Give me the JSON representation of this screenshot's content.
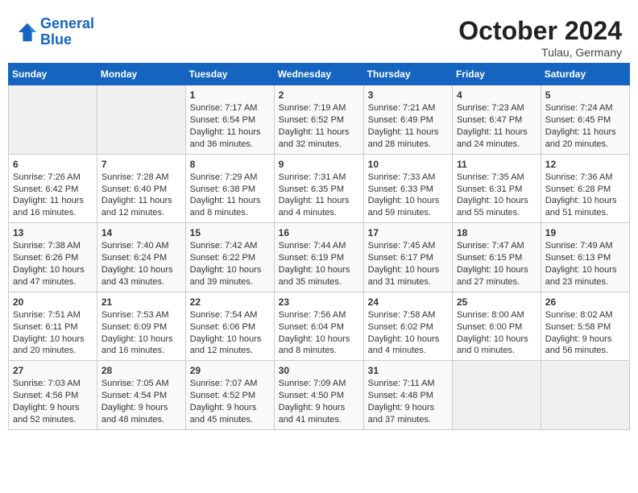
{
  "header": {
    "logo_line1": "General",
    "logo_line2": "Blue",
    "month_title": "October 2024",
    "location": "Tulau, Germany"
  },
  "days_of_week": [
    "Sunday",
    "Monday",
    "Tuesday",
    "Wednesday",
    "Thursday",
    "Friday",
    "Saturday"
  ],
  "weeks": [
    [
      {
        "day": "",
        "content": ""
      },
      {
        "day": "",
        "content": ""
      },
      {
        "day": "1",
        "content": "Sunrise: 7:17 AM\nSunset: 6:54 PM\nDaylight: 11 hours and 36 minutes."
      },
      {
        "day": "2",
        "content": "Sunrise: 7:19 AM\nSunset: 6:52 PM\nDaylight: 11 hours and 32 minutes."
      },
      {
        "day": "3",
        "content": "Sunrise: 7:21 AM\nSunset: 6:49 PM\nDaylight: 11 hours and 28 minutes."
      },
      {
        "day": "4",
        "content": "Sunrise: 7:23 AM\nSunset: 6:47 PM\nDaylight: 11 hours and 24 minutes."
      },
      {
        "day": "5",
        "content": "Sunrise: 7:24 AM\nSunset: 6:45 PM\nDaylight: 11 hours and 20 minutes."
      }
    ],
    [
      {
        "day": "6",
        "content": "Sunrise: 7:26 AM\nSunset: 6:42 PM\nDaylight: 11 hours and 16 minutes."
      },
      {
        "day": "7",
        "content": "Sunrise: 7:28 AM\nSunset: 6:40 PM\nDaylight: 11 hours and 12 minutes."
      },
      {
        "day": "8",
        "content": "Sunrise: 7:29 AM\nSunset: 6:38 PM\nDaylight: 11 hours and 8 minutes."
      },
      {
        "day": "9",
        "content": "Sunrise: 7:31 AM\nSunset: 6:35 PM\nDaylight: 11 hours and 4 minutes."
      },
      {
        "day": "10",
        "content": "Sunrise: 7:33 AM\nSunset: 6:33 PM\nDaylight: 10 hours and 59 minutes."
      },
      {
        "day": "11",
        "content": "Sunrise: 7:35 AM\nSunset: 6:31 PM\nDaylight: 10 hours and 55 minutes."
      },
      {
        "day": "12",
        "content": "Sunrise: 7:36 AM\nSunset: 6:28 PM\nDaylight: 10 hours and 51 minutes."
      }
    ],
    [
      {
        "day": "13",
        "content": "Sunrise: 7:38 AM\nSunset: 6:26 PM\nDaylight: 10 hours and 47 minutes."
      },
      {
        "day": "14",
        "content": "Sunrise: 7:40 AM\nSunset: 6:24 PM\nDaylight: 10 hours and 43 minutes."
      },
      {
        "day": "15",
        "content": "Sunrise: 7:42 AM\nSunset: 6:22 PM\nDaylight: 10 hours and 39 minutes."
      },
      {
        "day": "16",
        "content": "Sunrise: 7:44 AM\nSunset: 6:19 PM\nDaylight: 10 hours and 35 minutes."
      },
      {
        "day": "17",
        "content": "Sunrise: 7:45 AM\nSunset: 6:17 PM\nDaylight: 10 hours and 31 minutes."
      },
      {
        "day": "18",
        "content": "Sunrise: 7:47 AM\nSunset: 6:15 PM\nDaylight: 10 hours and 27 minutes."
      },
      {
        "day": "19",
        "content": "Sunrise: 7:49 AM\nSunset: 6:13 PM\nDaylight: 10 hours and 23 minutes."
      }
    ],
    [
      {
        "day": "20",
        "content": "Sunrise: 7:51 AM\nSunset: 6:11 PM\nDaylight: 10 hours and 20 minutes."
      },
      {
        "day": "21",
        "content": "Sunrise: 7:53 AM\nSunset: 6:09 PM\nDaylight: 10 hours and 16 minutes."
      },
      {
        "day": "22",
        "content": "Sunrise: 7:54 AM\nSunset: 6:06 PM\nDaylight: 10 hours and 12 minutes."
      },
      {
        "day": "23",
        "content": "Sunrise: 7:56 AM\nSunset: 6:04 PM\nDaylight: 10 hours and 8 minutes."
      },
      {
        "day": "24",
        "content": "Sunrise: 7:58 AM\nSunset: 6:02 PM\nDaylight: 10 hours and 4 minutes."
      },
      {
        "day": "25",
        "content": "Sunrise: 8:00 AM\nSunset: 6:00 PM\nDaylight: 10 hours and 0 minutes."
      },
      {
        "day": "26",
        "content": "Sunrise: 8:02 AM\nSunset: 5:58 PM\nDaylight: 9 hours and 56 minutes."
      }
    ],
    [
      {
        "day": "27",
        "content": "Sunrise: 7:03 AM\nSunset: 4:56 PM\nDaylight: 9 hours and 52 minutes."
      },
      {
        "day": "28",
        "content": "Sunrise: 7:05 AM\nSunset: 4:54 PM\nDaylight: 9 hours and 48 minutes."
      },
      {
        "day": "29",
        "content": "Sunrise: 7:07 AM\nSunset: 4:52 PM\nDaylight: 9 hours and 45 minutes."
      },
      {
        "day": "30",
        "content": "Sunrise: 7:09 AM\nSunset: 4:50 PM\nDaylight: 9 hours and 41 minutes."
      },
      {
        "day": "31",
        "content": "Sunrise: 7:11 AM\nSunset: 4:48 PM\nDaylight: 9 hours and 37 minutes."
      },
      {
        "day": "",
        "content": ""
      },
      {
        "day": "",
        "content": ""
      }
    ]
  ]
}
